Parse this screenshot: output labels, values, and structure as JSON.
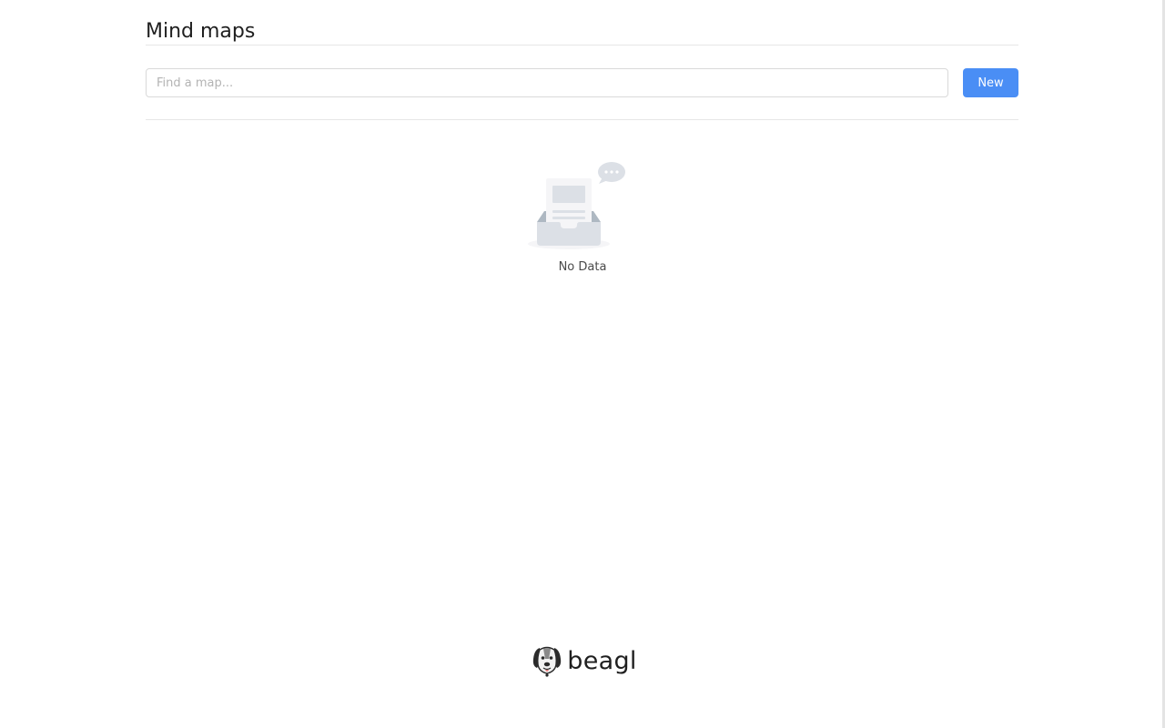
{
  "header": {
    "title": "Mind maps"
  },
  "toolbar": {
    "search_placeholder": "Find a map...",
    "search_value": "",
    "new_label": "New",
    "accent_color": "#4a8ef5"
  },
  "empty_state": {
    "text": "No Data",
    "icon": "empty-inbox-icon"
  },
  "footer": {
    "brand": "beagl",
    "icon": "beagle-dog-icon"
  }
}
